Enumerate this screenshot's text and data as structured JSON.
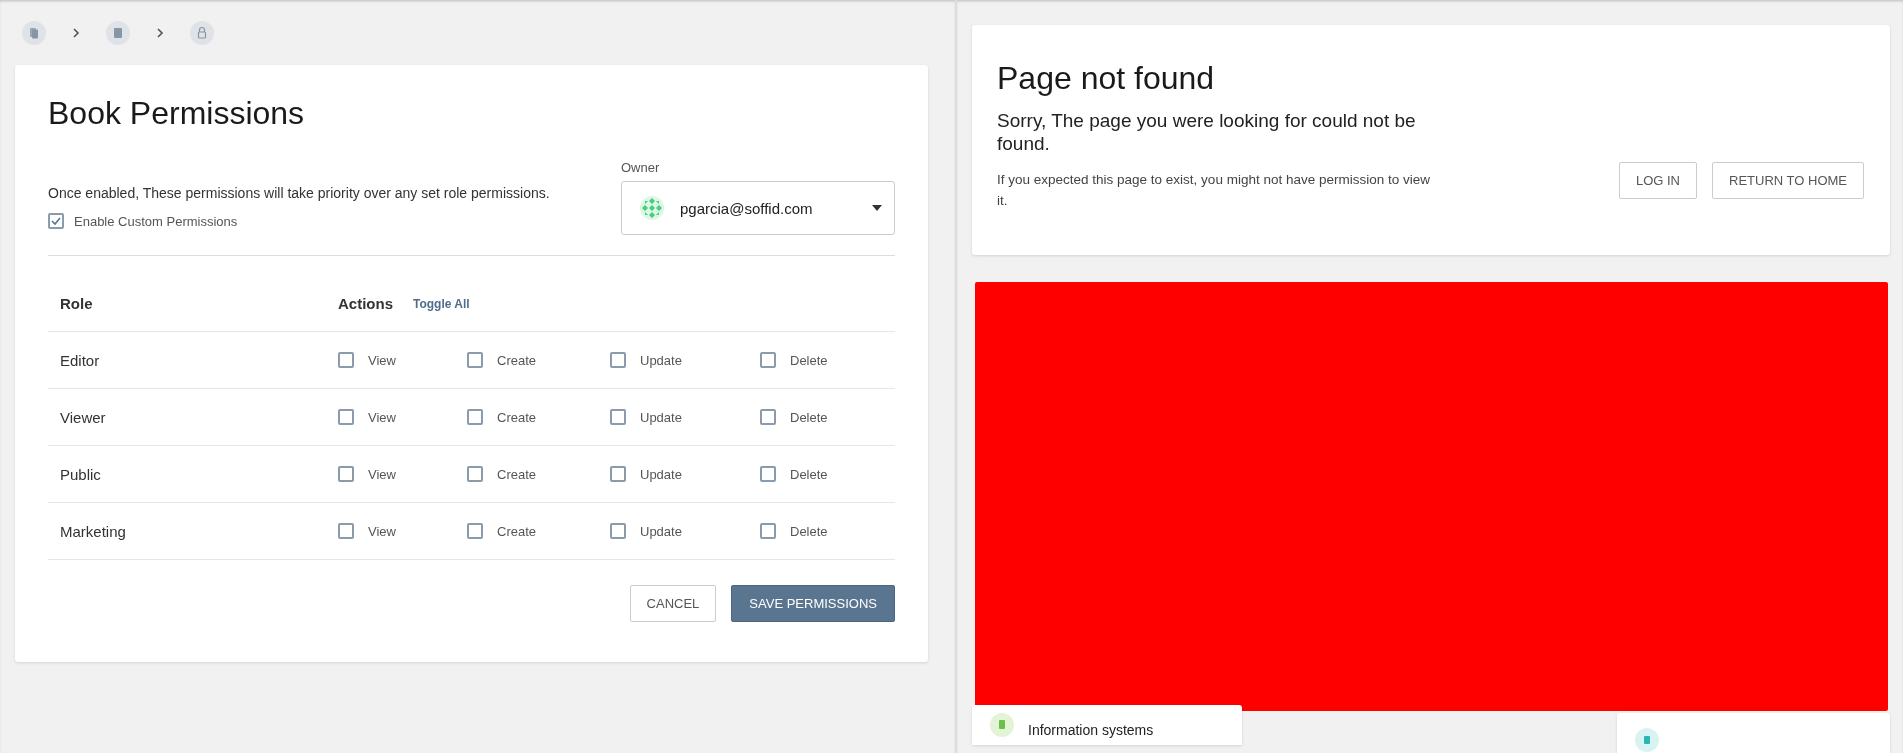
{
  "permissions": {
    "title": "Book Permissions",
    "description": "Once enabled, These permissions will take priority over any set role permissions.",
    "enable_custom": {
      "label": "Enable Custom Permissions",
      "checked": true
    },
    "owner": {
      "label": "Owner",
      "value": "pgarcia@soffid.com"
    },
    "table": {
      "columns": [
        "Role",
        "Actions"
      ],
      "toggle_all": "Toggle All",
      "rows": [
        {
          "role": "Editor",
          "actions": [
            {
              "label": "View",
              "checked": false
            },
            {
              "label": "Create",
              "checked": false
            },
            {
              "label": "Update",
              "checked": false
            },
            {
              "label": "Delete",
              "checked": false
            }
          ]
        },
        {
          "role": "Viewer",
          "actions": [
            {
              "label": "View",
              "checked": false
            },
            {
              "label": "Create",
              "checked": false
            },
            {
              "label": "Update",
              "checked": false
            },
            {
              "label": "Delete",
              "checked": false
            }
          ]
        },
        {
          "role": "Public",
          "actions": [
            {
              "label": "View",
              "checked": false
            },
            {
              "label": "Create",
              "checked": false
            },
            {
              "label": "Update",
              "checked": false
            },
            {
              "label": "Delete",
              "checked": false
            }
          ]
        },
        {
          "role": "Marketing",
          "actions": [
            {
              "label": "View",
              "checked": false
            },
            {
              "label": "Create",
              "checked": false
            },
            {
              "label": "Update",
              "checked": false
            },
            {
              "label": "Delete",
              "checked": false
            }
          ]
        }
      ]
    },
    "buttons": {
      "cancel": "CANCEL",
      "save": "SAVE PERMISSIONS"
    }
  },
  "not_found": {
    "title": "Page not found",
    "subtitle": "Sorry, The page you were looking for could not be found.",
    "text": "If you expected this page to exist, you might not have permission to view it.",
    "buttons": [
      "LOG IN",
      "RETURN TO HOME"
    ]
  },
  "bottom_cards": [
    {
      "label": "Information systems"
    }
  ]
}
